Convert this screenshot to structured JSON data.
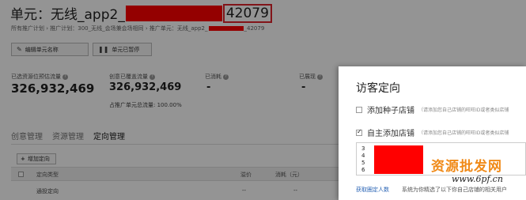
{
  "header": {
    "title_prefix": "单元：无线_app2_",
    "title_id": "42079",
    "breadcrumb_prefix": "所有推广计划 › 推广计划：300_无线_会场兼会场相同 › 推广单元：无线_app2_",
    "breadcrumb_suffix": "_42079"
  },
  "toolbar": {
    "edit_label": "编辑单元名称",
    "pause_label": "单元已暂停"
  },
  "stats": {
    "est_traffic_label": "已选资源位预估流量",
    "est_traffic_value": "326,932,469",
    "covered_label": "创意已覆盖流量",
    "covered_value": "326,932,469",
    "share_text": "占推广单元总流量: 100.00%",
    "spent_label": "已消耗",
    "spent_value": "-",
    "shown_label": "已展现",
    "shown_value": "-"
  },
  "tabs": [
    "创意管理",
    "资源管理",
    "定向管理"
  ],
  "table": {
    "add_label": "增加定向",
    "columns": [
      "定向类型",
      "溢价",
      "消耗（元）"
    ],
    "row": {
      "type": "通投定向",
      "premium": "--",
      "cost": "--"
    }
  },
  "dialog": {
    "title": "访客定向",
    "option1_label": "添加种子店铺",
    "option1_hint": "（请添加您自己店铺的旺旺ID或者类似店铺",
    "option2_label": "自主添加店铺",
    "option2_hint": "（请添加您自己店铺的旺旺ID或者类似店铺",
    "list_numbers": [
      "3",
      "4",
      "5",
      "6"
    ],
    "link_label": "获取圈定人数",
    "system_text": "系统为你精选了以下你自己店铺的相关用户"
  },
  "watermark": {
    "text": "资源批发网",
    "url": "www.6pf.cn"
  },
  "colors": {
    "redaction": "#ff0000",
    "highlight_box": "#e0242c",
    "link": "#2a64b5",
    "watermark": "#f08a18"
  },
  "icons": {
    "edit": "pencil-icon",
    "pause": "pause-icon",
    "help": "question-icon",
    "add": "plus-icon"
  }
}
